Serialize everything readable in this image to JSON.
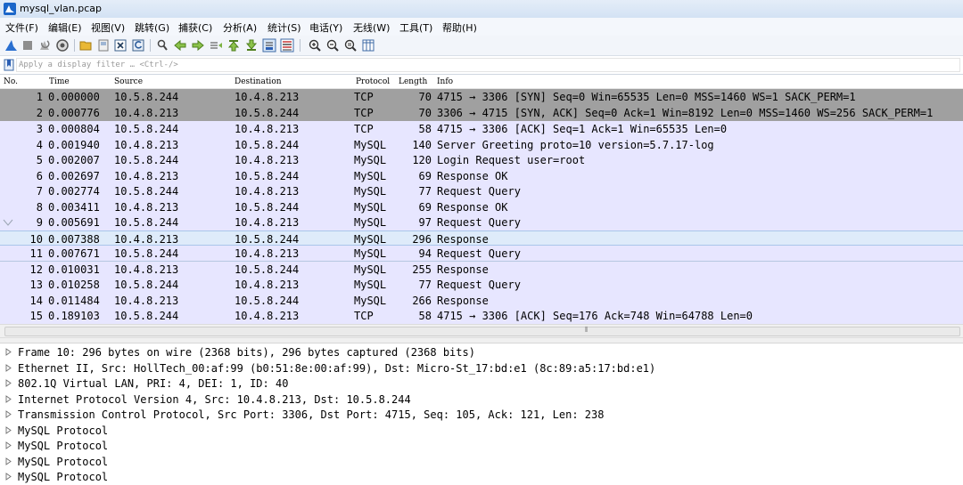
{
  "window": {
    "title": "mysql_vlan.pcap"
  },
  "menu": [
    "文件(F)",
    "编辑(E)",
    "视图(V)",
    "跳转(G)",
    "捕获(C)",
    "分析(A)",
    "统计(S)",
    "电话(Y)",
    "无线(W)",
    "工具(T)",
    "帮助(H)"
  ],
  "toolbar": {
    "icons": [
      "shark-fin-start-icon",
      "stop-icon",
      "restart-icon",
      "capture-options-icon",
      "open-folder-icon",
      "save-file-icon",
      "close-file-icon",
      "reload-icon",
      "find-packet-icon",
      "go-back-icon",
      "go-forward-icon",
      "go-to-packet-icon",
      "go-first-icon",
      "go-last-icon",
      "autoscroll-icon",
      "colorize-icon",
      "zoom-in-icon",
      "zoom-out-icon",
      "zoom-normal-icon",
      "resize-columns-icon"
    ]
  },
  "filter": {
    "placeholder": "Apply a display filter … <Ctrl-/>"
  },
  "columns": {
    "no": "No.",
    "time": "Time",
    "source": "Source",
    "destination": "Destination",
    "protocol": "Protocol",
    "length": "Length",
    "info": "Info"
  },
  "packets": [
    {
      "no": "1",
      "time": "0.000000",
      "source": "10.5.8.244",
      "destination": "10.4.8.213",
      "protocol": "TCP",
      "length": "70",
      "info": "4715 → 3306 [SYN] Seq=0 Win=65535 Len=0 MSS=1460 WS=1 SACK_PERM=1",
      "style": "syn"
    },
    {
      "no": "2",
      "time": "0.000776",
      "source": "10.4.8.213",
      "destination": "10.5.8.244",
      "protocol": "TCP",
      "length": "70",
      "info": "3306 → 4715 [SYN, ACK] Seq=0 Ack=1 Win=8192 Len=0 MSS=1460 WS=256 SACK_PERM=1",
      "style": "syn"
    },
    {
      "no": "3",
      "time": "0.000804",
      "source": "10.5.8.244",
      "destination": "10.4.8.213",
      "protocol": "TCP",
      "length": "58",
      "info": "4715 → 3306 [ACK] Seq=1 Ack=1 Win=65535 Len=0",
      "style": "norm"
    },
    {
      "no": "4",
      "time": "0.001940",
      "source": "10.4.8.213",
      "destination": "10.5.8.244",
      "protocol": "MySQL",
      "length": "140",
      "info": "Server Greeting proto=10 version=5.7.17-log",
      "style": "norm"
    },
    {
      "no": "5",
      "time": "0.002007",
      "source": "10.5.8.244",
      "destination": "10.4.8.213",
      "protocol": "MySQL",
      "length": "120",
      "info": "Login Request user=root",
      "style": "norm"
    },
    {
      "no": "6",
      "time": "0.002697",
      "source": "10.4.8.213",
      "destination": "10.5.8.244",
      "protocol": "MySQL",
      "length": "69",
      "info": "Response OK",
      "style": "norm"
    },
    {
      "no": "7",
      "time": "0.002774",
      "source": "10.5.8.244",
      "destination": "10.4.8.213",
      "protocol": "MySQL",
      "length": "77",
      "info": "Request Query",
      "style": "norm"
    },
    {
      "no": "8",
      "time": "0.003411",
      "source": "10.4.8.213",
      "destination": "10.5.8.244",
      "protocol": "MySQL",
      "length": "69",
      "info": "Response OK",
      "style": "norm"
    },
    {
      "no": "9",
      "time": "0.005691",
      "source": "10.5.8.244",
      "destination": "10.4.8.213",
      "protocol": "MySQL",
      "length": "97",
      "info": "Request Query",
      "style": "norm"
    },
    {
      "no": "10",
      "time": "0.007388",
      "source": "10.4.8.213",
      "destination": "10.5.8.244",
      "protocol": "MySQL",
      "length": "296",
      "info": "Response",
      "style": "sel"
    },
    {
      "no": "11",
      "time": "0.007671",
      "source": "10.5.8.244",
      "destination": "10.4.8.213",
      "protocol": "MySQL",
      "length": "94",
      "info": "Request Query",
      "style": "related"
    },
    {
      "no": "12",
      "time": "0.010031",
      "source": "10.4.8.213",
      "destination": "10.5.8.244",
      "protocol": "MySQL",
      "length": "255",
      "info": "Response",
      "style": "norm"
    },
    {
      "no": "13",
      "time": "0.010258",
      "source": "10.5.8.244",
      "destination": "10.4.8.213",
      "protocol": "MySQL",
      "length": "77",
      "info": "Request Query",
      "style": "norm"
    },
    {
      "no": "14",
      "time": "0.011484",
      "source": "10.4.8.213",
      "destination": "10.5.8.244",
      "protocol": "MySQL",
      "length": "266",
      "info": "Response",
      "style": "norm"
    },
    {
      "no": "15",
      "time": "0.189103",
      "source": "10.5.8.244",
      "destination": "10.4.8.213",
      "protocol": "TCP",
      "length": "58",
      "info": "4715 → 3306 [ACK] Seq=176 Ack=748 Win=64788 Len=0",
      "style": "norm"
    }
  ],
  "details": [
    "Frame 10: 296 bytes on wire (2368 bits), 296 bytes captured (2368 bits)",
    "Ethernet II, Src: HollTech_00:af:99 (b0:51:8e:00:af:99), Dst: Micro-St_17:bd:e1 (8c:89:a5:17:bd:e1)",
    "802.1Q Virtual LAN, PRI: 4, DEI: 1, ID: 40",
    "Internet Protocol Version 4, Src: 10.4.8.213, Dst: 10.5.8.244",
    "Transmission Control Protocol, Src Port: 3306, Dst Port: 4715, Seq: 105, Ack: 121, Len: 238",
    "MySQL Protocol",
    "MySQL Protocol",
    "MySQL Protocol",
    "MySQL Protocol"
  ],
  "colors": {
    "syn_row": "#a0a0a0",
    "normal_row": "#e7e6ff",
    "selected_row": "#deebfa",
    "accent": "#2b5fb4"
  }
}
